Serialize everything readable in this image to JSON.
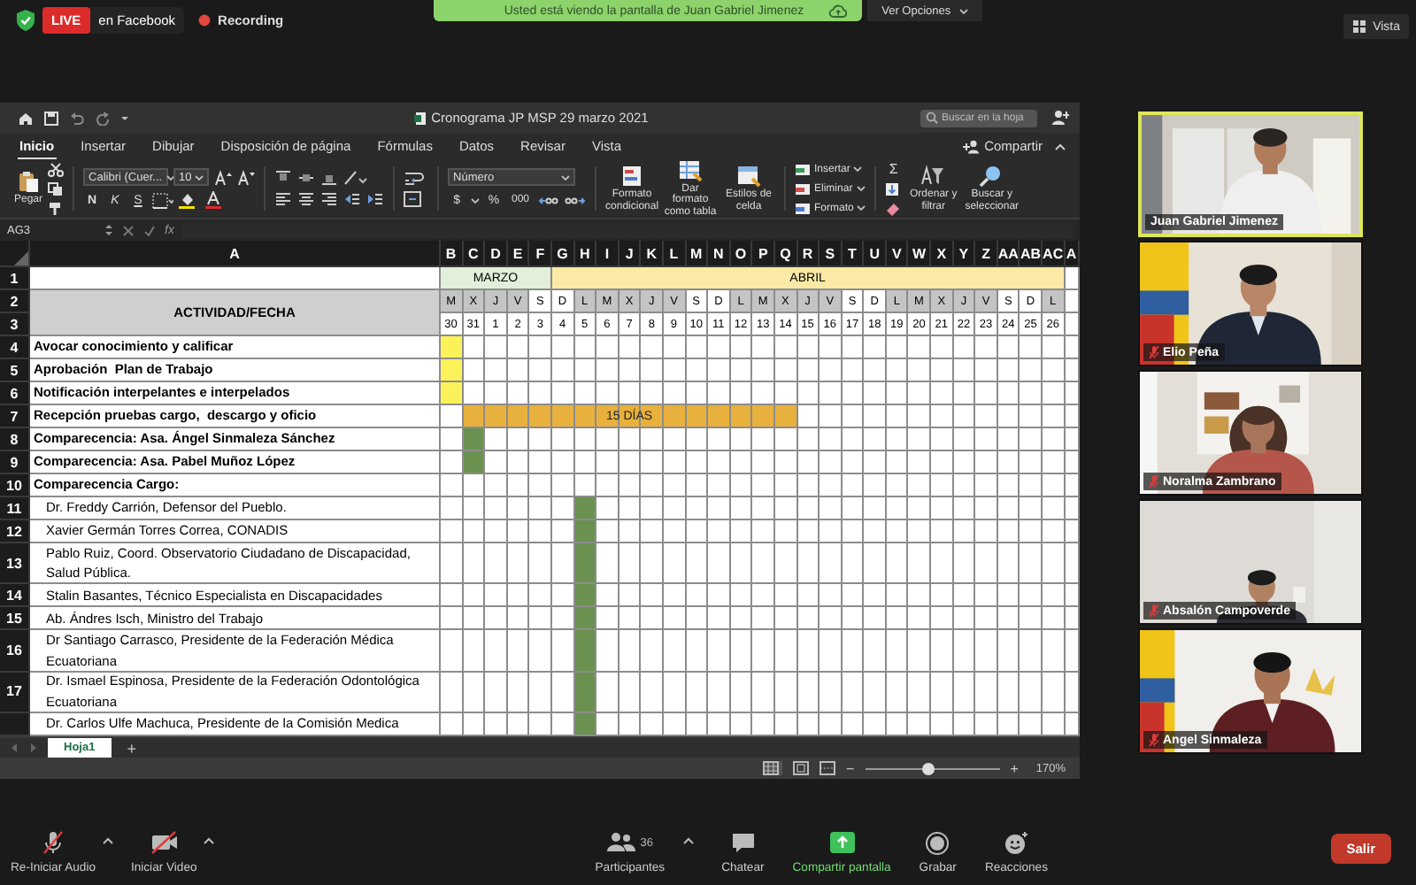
{
  "meeting_bar": {
    "live_badge": "LIVE",
    "live_target": "en Facebook",
    "recording": "Recording",
    "banner": "Usted está viendo la pantalla de Juan Gabriel Jimenez",
    "options_button": "Ver Opciones",
    "view_button": "Vista"
  },
  "excel": {
    "title": "Cronograma JP MSP 29 marzo 2021",
    "search": {
      "placeholder": "Buscar en la hoja"
    },
    "tabs": [
      {
        "label": "Inicio",
        "selected": true
      },
      {
        "label": "Insertar",
        "selected": false
      },
      {
        "label": "Dibujar",
        "selected": false
      },
      {
        "label": "Disposición de página",
        "selected": false
      },
      {
        "label": "Fórmulas",
        "selected": false
      },
      {
        "label": "Datos",
        "selected": false
      },
      {
        "label": "Revisar",
        "selected": false
      },
      {
        "label": "Vista",
        "selected": false
      }
    ],
    "share_button": "Compartir",
    "ribbon": {
      "paste": "Pegar",
      "font_name": "Calibri (Cuer...",
      "font_size": "10",
      "bold": "N",
      "italic": "K",
      "underline": "S",
      "number_format": "Número",
      "currency": "$",
      "percent": "%",
      "thousands": "000",
      "styles": [
        "Formato condicional",
        "Dar formato como tabla",
        "Estilos de celda"
      ],
      "cells": [
        "Insertar",
        "Eliminar",
        "Formato"
      ],
      "sum": "Σ",
      "editing": [
        "Ordenar y filtrar",
        "Buscar y seleccionar"
      ]
    },
    "name_box": "AG3",
    "function_label": "fx",
    "sheet": {
      "columns": [
        "A",
        "B",
        "C",
        "D",
        "E",
        "F",
        "G",
        "H",
        "I",
        "J",
        "K",
        "L",
        "M",
        "N",
        "O",
        "P",
        "Q",
        "R",
        "S",
        "T",
        "U",
        "V",
        "W",
        "X",
        "Y",
        "Z",
        "AA",
        "AB",
        "AC",
        "A"
      ],
      "header_rows": [
        "1",
        "2",
        "3"
      ],
      "header_title": "ACTIVIDAD/FECHA",
      "months": [
        {
          "label": "MARZO",
          "color": "#e2efda",
          "days": [
            {
              "letter": "M",
              "date": "30",
              "weekend": false
            },
            {
              "letter": "X",
              "date": "31",
              "weekend": false
            },
            {
              "letter": "J",
              "date": "1",
              "weekend": false
            },
            {
              "letter": "V",
              "date": "2",
              "weekend": false
            },
            {
              "letter": "S",
              "date": "3",
              "weekend": true
            }
          ]
        },
        {
          "label": "ABRIL",
          "color": "#fce9a6",
          "days": [
            {
              "letter": "D",
              "date": "4",
              "weekend": true
            },
            {
              "letter": "L",
              "date": "5",
              "weekend": false
            },
            {
              "letter": "M",
              "date": "6",
              "weekend": false
            },
            {
              "letter": "X",
              "date": "7",
              "weekend": false
            },
            {
              "letter": "J",
              "date": "8",
              "weekend": false
            },
            {
              "letter": "V",
              "date": "9",
              "weekend": false
            },
            {
              "letter": "S",
              "date": "10",
              "weekend": true
            },
            {
              "letter": "D",
              "date": "11",
              "weekend": true
            },
            {
              "letter": "L",
              "date": "12",
              "weekend": false
            },
            {
              "letter": "M",
              "date": "13",
              "weekend": false
            },
            {
              "letter": "X",
              "date": "14",
              "weekend": false
            },
            {
              "letter": "J",
              "date": "15",
              "weekend": false
            },
            {
              "letter": "V",
              "date": "16",
              "weekend": false
            },
            {
              "letter": "S",
              "date": "17",
              "weekend": true
            },
            {
              "letter": "D",
              "date": "18",
              "weekend": true
            },
            {
              "letter": "L",
              "date": "19",
              "weekend": false
            },
            {
              "letter": "M",
              "date": "20",
              "weekend": false
            },
            {
              "letter": "X",
              "date": "21",
              "weekend": false
            },
            {
              "letter": "J",
              "date": "22",
              "weekend": false
            },
            {
              "letter": "V",
              "date": "23",
              "weekend": false
            },
            {
              "letter": "S",
              "date": "24",
              "weekend": true
            },
            {
              "letter": "D",
              "date": "25",
              "weekend": true
            },
            {
              "letter": "L",
              "date": "26",
              "weekend": false
            }
          ]
        }
      ],
      "rows": [
        {
          "number": "4",
          "kind": "section",
          "activity": "Avocar conocimiento y calificar",
          "color": "#fbf25a",
          "filled": [
            true,
            false,
            false,
            false,
            false,
            false,
            false,
            false,
            false,
            false,
            false,
            false,
            false,
            false,
            false,
            false,
            false,
            false,
            false,
            false,
            false,
            false,
            false,
            false,
            false,
            false,
            false,
            false
          ]
        },
        {
          "number": "5",
          "kind": "section",
          "activity": "Aprobación  Plan de Trabajo",
          "color": "#fbf25a",
          "filled": [
            true,
            false,
            false,
            false,
            false,
            false,
            false,
            false,
            false,
            false,
            false,
            false,
            false,
            false,
            false,
            false,
            false,
            false,
            false,
            false,
            false,
            false,
            false,
            false,
            false,
            false,
            false,
            false
          ]
        },
        {
          "number": "6",
          "kind": "section",
          "activity": "Notificación interpelantes e interpelados",
          "color": "#fbf25a",
          "filled": [
            true,
            false,
            false,
            false,
            false,
            false,
            false,
            false,
            false,
            false,
            false,
            false,
            false,
            false,
            false,
            false,
            false,
            false,
            false,
            false,
            false,
            false,
            false,
            false,
            false,
            false,
            false,
            false
          ]
        },
        {
          "number": "7",
          "kind": "section",
          "activity": "Recepción pruebas cargo,  descargo y oficio",
          "color": "#e8b13d",
          "bar_label": "15 DÍAS",
          "filled": [
            false,
            true,
            true,
            true,
            true,
            true,
            true,
            true,
            true,
            true,
            true,
            true,
            true,
            true,
            true,
            true,
            false,
            false,
            false,
            false,
            false,
            false,
            false,
            false,
            false,
            false,
            false,
            false
          ]
        },
        {
          "number": "8",
          "kind": "section",
          "activity": "Comparecencia: Asa. Ángel Sinmaleza Sánchez",
          "color": "#6b9150",
          "filled": [
            false,
            true,
            false,
            false,
            false,
            false,
            false,
            false,
            false,
            false,
            false,
            false,
            false,
            false,
            false,
            false,
            false,
            false,
            false,
            false,
            false,
            false,
            false,
            false,
            false,
            false,
            false,
            false
          ]
        },
        {
          "number": "9",
          "kind": "section",
          "activity": "Comparecencia: Asa. Pabel Muñoz López",
          "color": "#6b9150",
          "filled": [
            false,
            true,
            false,
            false,
            false,
            false,
            false,
            false,
            false,
            false,
            false,
            false,
            false,
            false,
            false,
            false,
            false,
            false,
            false,
            false,
            false,
            false,
            false,
            false,
            false,
            false,
            false,
            false
          ]
        },
        {
          "number": "10",
          "kind": "section",
          "activity": "Comparecencia Cargo:",
          "filled": [
            false,
            false,
            false,
            false,
            false,
            false,
            false,
            false,
            false,
            false,
            false,
            false,
            false,
            false,
            false,
            false,
            false,
            false,
            false,
            false,
            false,
            false,
            false,
            false,
            false,
            false,
            false,
            false
          ]
        },
        {
          "number": "11",
          "kind": "entry",
          "activity": "Dr. Freddy Carrión, Defensor del Pueblo.",
          "color": "#6b9150",
          "filled": [
            false,
            false,
            false,
            false,
            false,
            false,
            true,
            false,
            false,
            false,
            false,
            false,
            false,
            false,
            false,
            false,
            false,
            false,
            false,
            false,
            false,
            false,
            false,
            false,
            false,
            false,
            false,
            false
          ]
        },
        {
          "number": "12",
          "kind": "entry",
          "activity": "Xavier Germán Torres Correa, CONADIS",
          "color": "#6b9150",
          "filled": [
            false,
            false,
            false,
            false,
            false,
            false,
            true,
            false,
            false,
            false,
            false,
            false,
            false,
            false,
            false,
            false,
            false,
            false,
            false,
            false,
            false,
            false,
            false,
            false,
            false,
            false,
            false,
            false
          ]
        },
        {
          "number": "13",
          "kind": "entry",
          "activity": "Pablo Ruiz, Coord. Observatorio Ciudadano de Discapacidad, Salud Pública.",
          "color": "#6b9150",
          "filled": [
            false,
            false,
            false,
            false,
            false,
            false,
            true,
            false,
            false,
            false,
            false,
            false,
            false,
            false,
            false,
            false,
            false,
            false,
            false,
            false,
            false,
            false,
            false,
            false,
            false,
            false,
            false,
            false
          ]
        },
        {
          "number": "14",
          "kind": "entry",
          "activity": "Stalin Basantes, Técnico Especialista en Discapacidades",
          "color": "#6b9150",
          "filled": [
            false,
            false,
            false,
            false,
            false,
            false,
            true,
            false,
            false,
            false,
            false,
            false,
            false,
            false,
            false,
            false,
            false,
            false,
            false,
            false,
            false,
            false,
            false,
            false,
            false,
            false,
            false,
            false
          ]
        },
        {
          "number": "15",
          "kind": "entry",
          "activity": "Ab. Ándres Isch, Ministro del Trabajo",
          "color": "#6b9150",
          "filled": [
            false,
            false,
            false,
            false,
            false,
            false,
            true,
            false,
            false,
            false,
            false,
            false,
            false,
            false,
            false,
            false,
            false,
            false,
            false,
            false,
            false,
            false,
            false,
            false,
            false,
            false,
            false,
            false
          ]
        },
        {
          "number": "16",
          "kind": "entry",
          "activity": "Dr Santiago Carrasco, Presidente de la Federación Médica Ecuatoriana",
          "color": "#6b9150",
          "filled": [
            false,
            false,
            false,
            false,
            false,
            false,
            true,
            false,
            false,
            false,
            false,
            false,
            false,
            false,
            false,
            false,
            false,
            false,
            false,
            false,
            false,
            false,
            false,
            false,
            false,
            false,
            false,
            false
          ]
        },
        {
          "number": "17",
          "kind": "entry",
          "activity": "Dr. Ismael Espinosa, Presidente de la Federación Odontológica Ecuatoriana",
          "color": "#6b9150",
          "filled": [
            false,
            false,
            false,
            false,
            false,
            false,
            true,
            false,
            false,
            false,
            false,
            false,
            false,
            false,
            false,
            false,
            false,
            false,
            false,
            false,
            false,
            false,
            false,
            false,
            false,
            false,
            false,
            false
          ]
        },
        {
          "kind": "entry",
          "activity": "Dr. Carlos Ulfe Machuca, Presidente de la Comisión Medica",
          "color": "#6b9150",
          "filled": [
            false,
            false,
            false,
            false,
            false,
            false,
            true,
            false,
            false,
            false,
            false,
            false,
            false,
            false,
            false,
            false,
            false,
            false,
            false,
            false,
            false,
            false,
            false,
            false,
            false,
            false,
            false,
            false
          ]
        }
      ]
    },
    "sheet_tabs": [
      {
        "label": "Hoja1",
        "selected": true
      }
    ],
    "add_sheet": "+",
    "zoom": {
      "zoom_out": "−",
      "zoom_in": "+",
      "level": 0.47,
      "reading": "170%"
    }
  },
  "participants": [
    {
      "name": "Juan Gabriel Jimenez",
      "muted": false,
      "speaking": true
    },
    {
      "name": "Elio Peña",
      "muted": true,
      "speaking": false
    },
    {
      "name": "Noralma Zambrano",
      "muted": true,
      "speaking": false
    },
    {
      "name": "Absalón Campoverde",
      "muted": true,
      "speaking": false
    },
    {
      "name": "Angel Sinmaleza",
      "muted": true,
      "speaking": false
    }
  ],
  "toolbar": {
    "audio": "Re-Iniciar Audio",
    "video": "Iniciar Video",
    "participants": "Participantes",
    "participant_count": "36",
    "chat": "Chatear",
    "share": "Compartir pantalla",
    "record": "Grabar",
    "reactions": "Reacciones",
    "leave": "Salir"
  }
}
